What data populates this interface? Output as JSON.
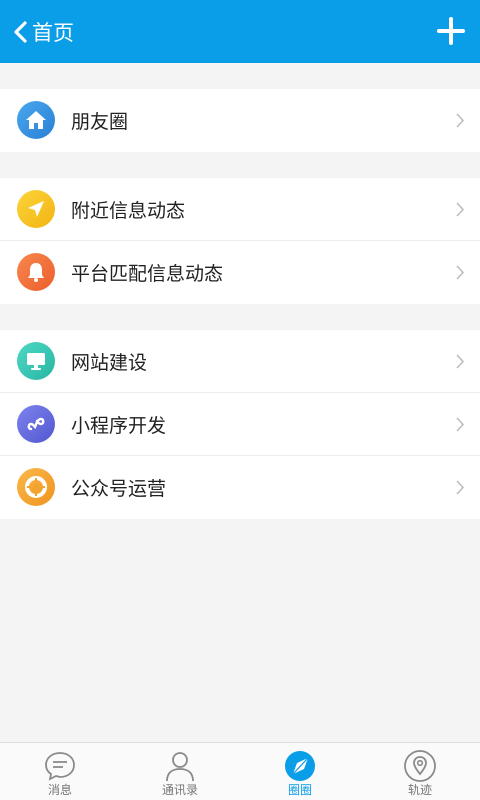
{
  "header": {
    "back_label": "首页"
  },
  "menu": {
    "groups": [
      {
        "items": [
          {
            "label": "朋友圈",
            "icon": "home-icon",
            "color": "#3b8fe0"
          }
        ]
      },
      {
        "items": [
          {
            "label": "附近信息动态",
            "icon": "location-arrow-icon",
            "color": "#f7c21f"
          },
          {
            "label": "平台匹配信息动态",
            "icon": "bell-icon",
            "color": "#f0733b"
          }
        ]
      },
      {
        "items": [
          {
            "label": "网站建设",
            "icon": "monitor-icon",
            "color": "#36c9b5"
          },
          {
            "label": "小程序开发",
            "icon": "mini-program-icon",
            "color": "#6a6fe0"
          },
          {
            "label": "公众号运营",
            "icon": "lifebuoy-icon",
            "color": "#f6a52e"
          }
        ]
      }
    ]
  },
  "tabbar": {
    "tabs": [
      {
        "label": "消息",
        "icon": "chat-bubble-icon"
      },
      {
        "label": "通讯录",
        "icon": "contacts-person-icon"
      },
      {
        "label": "圈圈",
        "icon": "compass-icon",
        "active": true
      },
      {
        "label": "轨迹",
        "icon": "map-pin-icon"
      }
    ]
  },
  "colors": {
    "brand": "#0a9de8",
    "background": "#f4f4f4"
  }
}
